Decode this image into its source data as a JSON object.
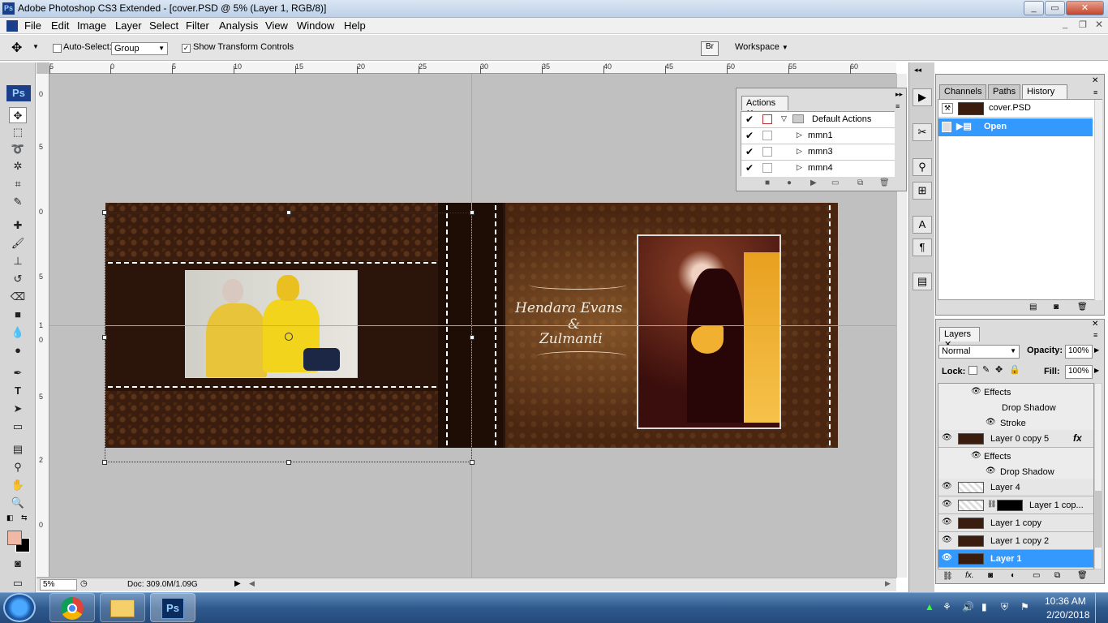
{
  "window": {
    "title": "Adobe Photoshop CS3 Extended - [cover.PSD @ 5% (Layer 1, RGB/8)]",
    "ps_logo": "Ps"
  },
  "menu": [
    "File",
    "Edit",
    "Image",
    "Layer",
    "Select",
    "Filter",
    "Analysis",
    "View",
    "Window",
    "Help"
  ],
  "options": {
    "auto_select_label": "Auto-Select:",
    "auto_select_value": "Group",
    "show_transform_label": "Show Transform Controls",
    "workspace_label": "Workspace"
  },
  "ruler_h": [
    "5",
    "0",
    "5",
    "10",
    "15",
    "20",
    "25",
    "30",
    "35",
    "40",
    "45",
    "50",
    "55",
    "60"
  ],
  "ruler_v": [
    "0",
    "5",
    "0",
    "5",
    "1",
    "0",
    "5",
    "2",
    "0",
    "5",
    "3"
  ],
  "artwork": {
    "title_line1": "Hendara Evans",
    "amp": "&",
    "title_line2": "Zulmanti"
  },
  "status": {
    "zoom": "5%",
    "doc": "Doc: 309.0M/1.09G"
  },
  "actions": {
    "tab": "Actions",
    "set": "Default Actions",
    "items": [
      "mmn1",
      "mmn3",
      "mmn4"
    ]
  },
  "history": {
    "tabs": [
      "Channels",
      "Paths",
      "History"
    ],
    "snapshot": "cover.PSD",
    "state": "Open"
  },
  "layers": {
    "tab": "Layers",
    "blend": "Normal",
    "opacity_label": "Opacity:",
    "opacity": "100%",
    "lock_label": "Lock:",
    "fill_label": "Fill:",
    "fill": "100%",
    "rows": [
      {
        "name": "Effects",
        "indent": 1,
        "eye": true
      },
      {
        "name": "Drop Shadow",
        "indent": 2,
        "eye": false
      },
      {
        "name": "Stroke",
        "indent": 2,
        "eye": true
      },
      {
        "name": "Layer 0 copy 5",
        "indent": 0,
        "eye": true,
        "fx": "fx"
      },
      {
        "name": "Effects",
        "indent": 1,
        "eye": true
      },
      {
        "name": "Drop Shadow",
        "indent": 2,
        "eye": true
      },
      {
        "name": "Layer 4",
        "indent": 0,
        "eye": true
      },
      {
        "name": "Layer 1 cop...",
        "indent": 0,
        "eye": true
      },
      {
        "name": "Layer 1 copy",
        "indent": 0,
        "eye": true
      },
      {
        "name": "Layer 1 copy 2",
        "indent": 0,
        "eye": true
      },
      {
        "name": "Layer 1",
        "indent": 0,
        "eye": true,
        "selected": true
      }
    ]
  },
  "clock": {
    "time": "10:36 AM",
    "date": "2/20/2018"
  },
  "taskbar": {
    "ps_app": "Ps"
  }
}
